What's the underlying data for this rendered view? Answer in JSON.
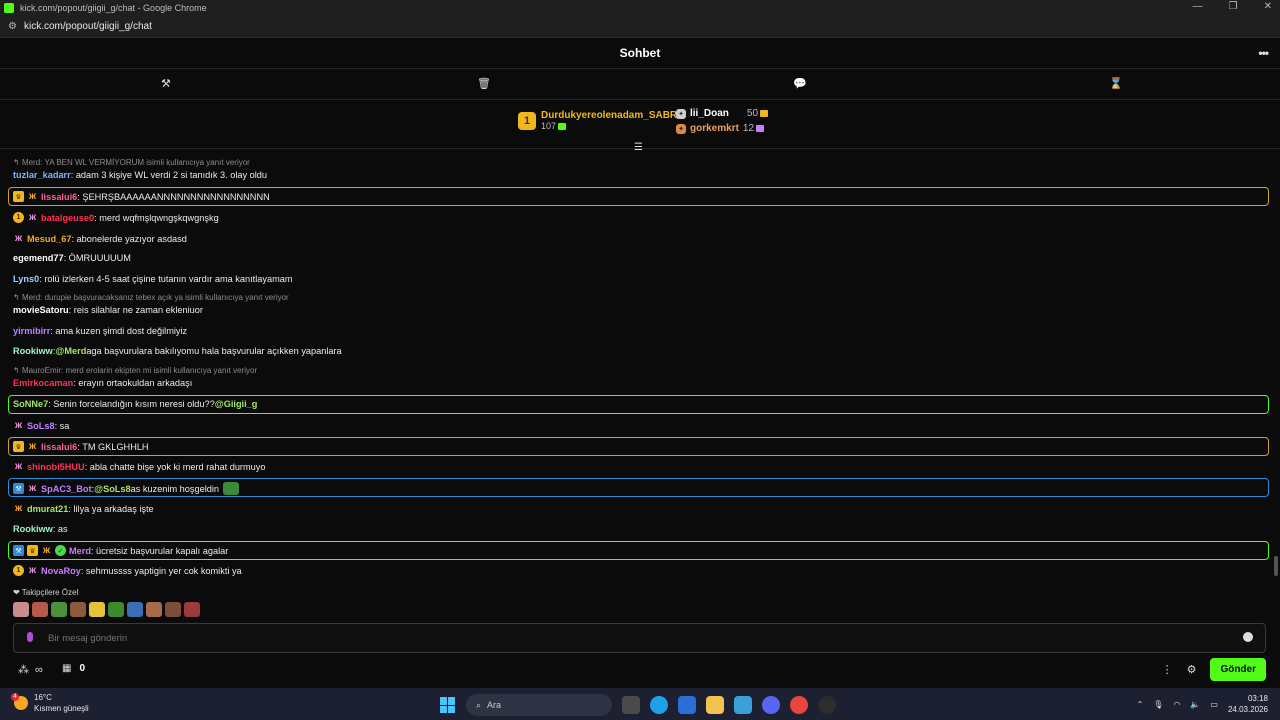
{
  "browser": {
    "window_title": "kick.com/popout/giigii_g/chat - Google Chrome",
    "url": "kick.com/popout/giigii_g/chat"
  },
  "chat": {
    "title": "Sohbet",
    "toolbar_icons": [
      "hammer-icon",
      "trash-icon",
      "chat-bubble-icon",
      "hourglass-icon"
    ]
  },
  "leaderboard": {
    "first": {
      "rank": "1",
      "name": "Durdukyereolenadam_SABRI",
      "count": "107"
    },
    "second": {
      "name": "lii_Doan",
      "count": "50"
    },
    "third": {
      "name": "gorkemkrt",
      "count": "12"
    }
  },
  "messages": [
    {
      "reply": "Merd: YA BEN WL VERMİYORUM isimli kullanıcıya yanıt veriyor"
    },
    {
      "user": "tuzlar_kadarr",
      "color": "#7fb4ff",
      "text": ": adam 3 kişiye WL verdi 2 si tanıdık 3. olay oldu"
    },
    {
      "user": "lissalui6",
      "color": "#ff5e9a",
      "text": ": ŞEHRŞBAAAAAANNNNNNNNNNNNNNNNN",
      "highlight": "#c9a227"
    },
    {
      "user": "batalgeuse0",
      "color": "#ff3355",
      "text": ": merd wqfmşlqwngşkqwgnşkg"
    },
    {
      "user": "Mesud_67",
      "color": "#f5a623",
      "text": ": abonelerde yazıyor asdasd"
    },
    {
      "user": "egemend77",
      "color": "#ffffff",
      "text": ": ÖMRUUUUUM"
    },
    {
      "user": "Lyns0",
      "color": "#9fd0ff",
      "text": ": rolü izlerken 4-5 saat çişine tutanın vardır ama kanıtlayamam"
    },
    {
      "reply": "Merd: durupie başvuracaksanız tebex açık ya isimli kullanıcıya yanıt veriyor"
    },
    {
      "user": "movieSatoru",
      "color": "#ffffff",
      "text": ": reis silahlar ne zaman ekleniuor"
    },
    {
      "user": "yirmibirr",
      "color": "#c77dff",
      "text": ": ama kuzen şimdi dost değilmiyiz"
    },
    {
      "user": "Rookiww",
      "color": "#9ff5c4",
      "mention": "@Merd",
      "text": " aga başvurulara bakılıyomu hala başvurular açıkken yapanlara"
    },
    {
      "reply": "MauroEmir: merd erolarin ekipten mi isimli kullanıcıya yanıt veriyor"
    },
    {
      "user": "Emirkocaman",
      "color": "#ff3355",
      "text": ": erayın ortaokuldan arkadaşı"
    },
    {
      "user": "SoNNe7",
      "color": "#a3e66a",
      "text": ": Senin forcelandığın kısım neresi oldu?? ",
      "mention_end": "@Giigii_g",
      "highlight": "#53fc18"
    },
    {
      "user": "SoLs8",
      "color": "#c77dff",
      "text": ": sa"
    },
    {
      "user": "lissalui6",
      "color": "#ff5e9a",
      "text": ": TM GKLGHHLH",
      "highlight": "#c9a227"
    },
    {
      "user": "shinobi5HUU",
      "color": "#ff3355",
      "text": ": abla chatte bişe yok ki merd rahat durmuyo"
    },
    {
      "user": "SpAC3_Bot",
      "color": "#c77dff",
      "mention": "@SoLs8",
      "text": " as kuzenim hoşgeldin",
      "highlight": "#2e8bd8"
    },
    {
      "user": "dmurat21",
      "color": "#a3e66a",
      "text": ": lilya ya arkadaş işte"
    },
    {
      "user": "Rookiww",
      "color": "#9ff5c4",
      "text": ": as"
    },
    {
      "user": "Merd",
      "color": "#c77dff",
      "text": ": ücretsiz başvurular kapalı agalar",
      "highlight": "#53fc18"
    },
    {
      "user": "NovaRoy",
      "color": "#c77dff",
      "text": ": sehmussss yaptigin yer cok komikti ya"
    }
  ],
  "emotes_label": "Takipçilere Özel",
  "input": {
    "placeholder": "Bir mesaj gönderin"
  },
  "bottom": {
    "points": "0",
    "send_label": "Gönder"
  },
  "taskbar": {
    "temp": "16°C",
    "weather": "Kısmen güneşli",
    "weather_badge": "4",
    "search_placeholder": "Ara",
    "time": "03:18",
    "date": "24.03.2026"
  }
}
